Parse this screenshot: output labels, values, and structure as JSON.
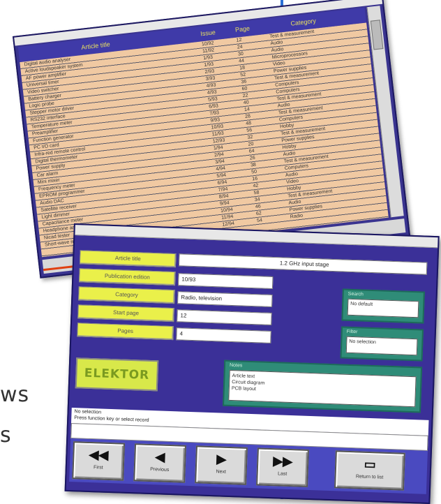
{
  "side_text": {
    "line1": "ws",
    "line2": "s"
  },
  "list_window": {
    "columns": [
      "Article title",
      "Issue",
      "Page",
      "Category"
    ],
    "rows": [
      [
        "Digital audio analyser",
        "10/92",
        "12",
        "Test & measurement"
      ],
      [
        "Active loudspeaker system",
        "11/92",
        "24",
        "Audio"
      ],
      [
        "AF power amplifier",
        "1/93",
        "30",
        "Audio"
      ],
      [
        "Universal timer",
        "1/93",
        "44",
        "Microprocessors"
      ],
      [
        "Video switcher",
        "2/93",
        "18",
        "Video"
      ],
      [
        "Battery charger",
        "3/93",
        "52",
        "Power supplies"
      ],
      [
        "Logic probe",
        "4/93",
        "36",
        "Test & measurement"
      ],
      [
        "Stepper motor driver",
        "4/93",
        "60",
        "Computers"
      ],
      [
        "RS232 interface",
        "5/93",
        "22",
        "Computers"
      ],
      [
        "Temperature meter",
        "6/93",
        "40",
        "Test & measurement"
      ],
      [
        "Preamplifier",
        "7/93",
        "14",
        "Audio"
      ],
      [
        "Function generator",
        "9/93",
        "28",
        "Test & measurement"
      ],
      [
        "PC I/O card",
        "10/93",
        "48",
        "Computers"
      ],
      [
        "Infra-red remote control",
        "11/93",
        "56",
        "Hobby"
      ],
      [
        "Digital thermometer",
        "12/93",
        "32",
        "Test & measurement"
      ],
      [
        "Power supply",
        "1/94",
        "20",
        "Power supplies"
      ],
      [
        "Car alarm",
        "2/94",
        "64",
        "Hobby"
      ],
      [
        "Mini mixer",
        "3/94",
        "26",
        "Audio"
      ],
      [
        "Frequency meter",
        "4/94",
        "38",
        "Test & measurement"
      ],
      [
        "EPROM programmer",
        "5/94",
        "50",
        "Computers"
      ],
      [
        "Audio DAC",
        "6/94",
        "16",
        "Audio"
      ],
      [
        "Satellite receiver",
        "7/94",
        "42",
        "Video"
      ],
      [
        "Light dimmer",
        "8/94",
        "58",
        "Hobby"
      ],
      [
        "Capacitance meter",
        "9/94",
        "34",
        "Test & measurement"
      ],
      [
        "Headphone amplifier",
        "10/94",
        "46",
        "Audio"
      ],
      [
        "Nicad tester",
        "11/94",
        "62",
        "Power supplies"
      ],
      [
        "Short-wave receiver",
        "12/94",
        "54",
        "Radio"
      ]
    ]
  },
  "form_window": {
    "fields": [
      {
        "label": "Article title",
        "value": "1.2 GHz input stage"
      },
      {
        "label": "Publication edition",
        "value": "10/93"
      },
      {
        "label": "Category",
        "value": "Radio, television"
      },
      {
        "label": "Start page",
        "value": "12"
      },
      {
        "label": "Pages",
        "value": "4"
      }
    ],
    "box1": {
      "title": "Search",
      "value": "No default"
    },
    "box2": {
      "title": "Filter",
      "value": "No selection"
    },
    "box3": {
      "title": "Notes",
      "lines": [
        "Article text",
        "Circuit diagram",
        "PCB layout"
      ]
    },
    "logo": "ELEKTOR",
    "status_lines": [
      "No selection",
      "Press function key or select record"
    ],
    "buttons": [
      {
        "icon": "◀◀",
        "label": "First"
      },
      {
        "icon": "◀",
        "label": "Previous"
      },
      {
        "icon": "▶",
        "label": "Next"
      },
      {
        "icon": "▶▶",
        "label": "Last"
      },
      {
        "icon": "▭",
        "label": "Return to list"
      }
    ]
  }
}
